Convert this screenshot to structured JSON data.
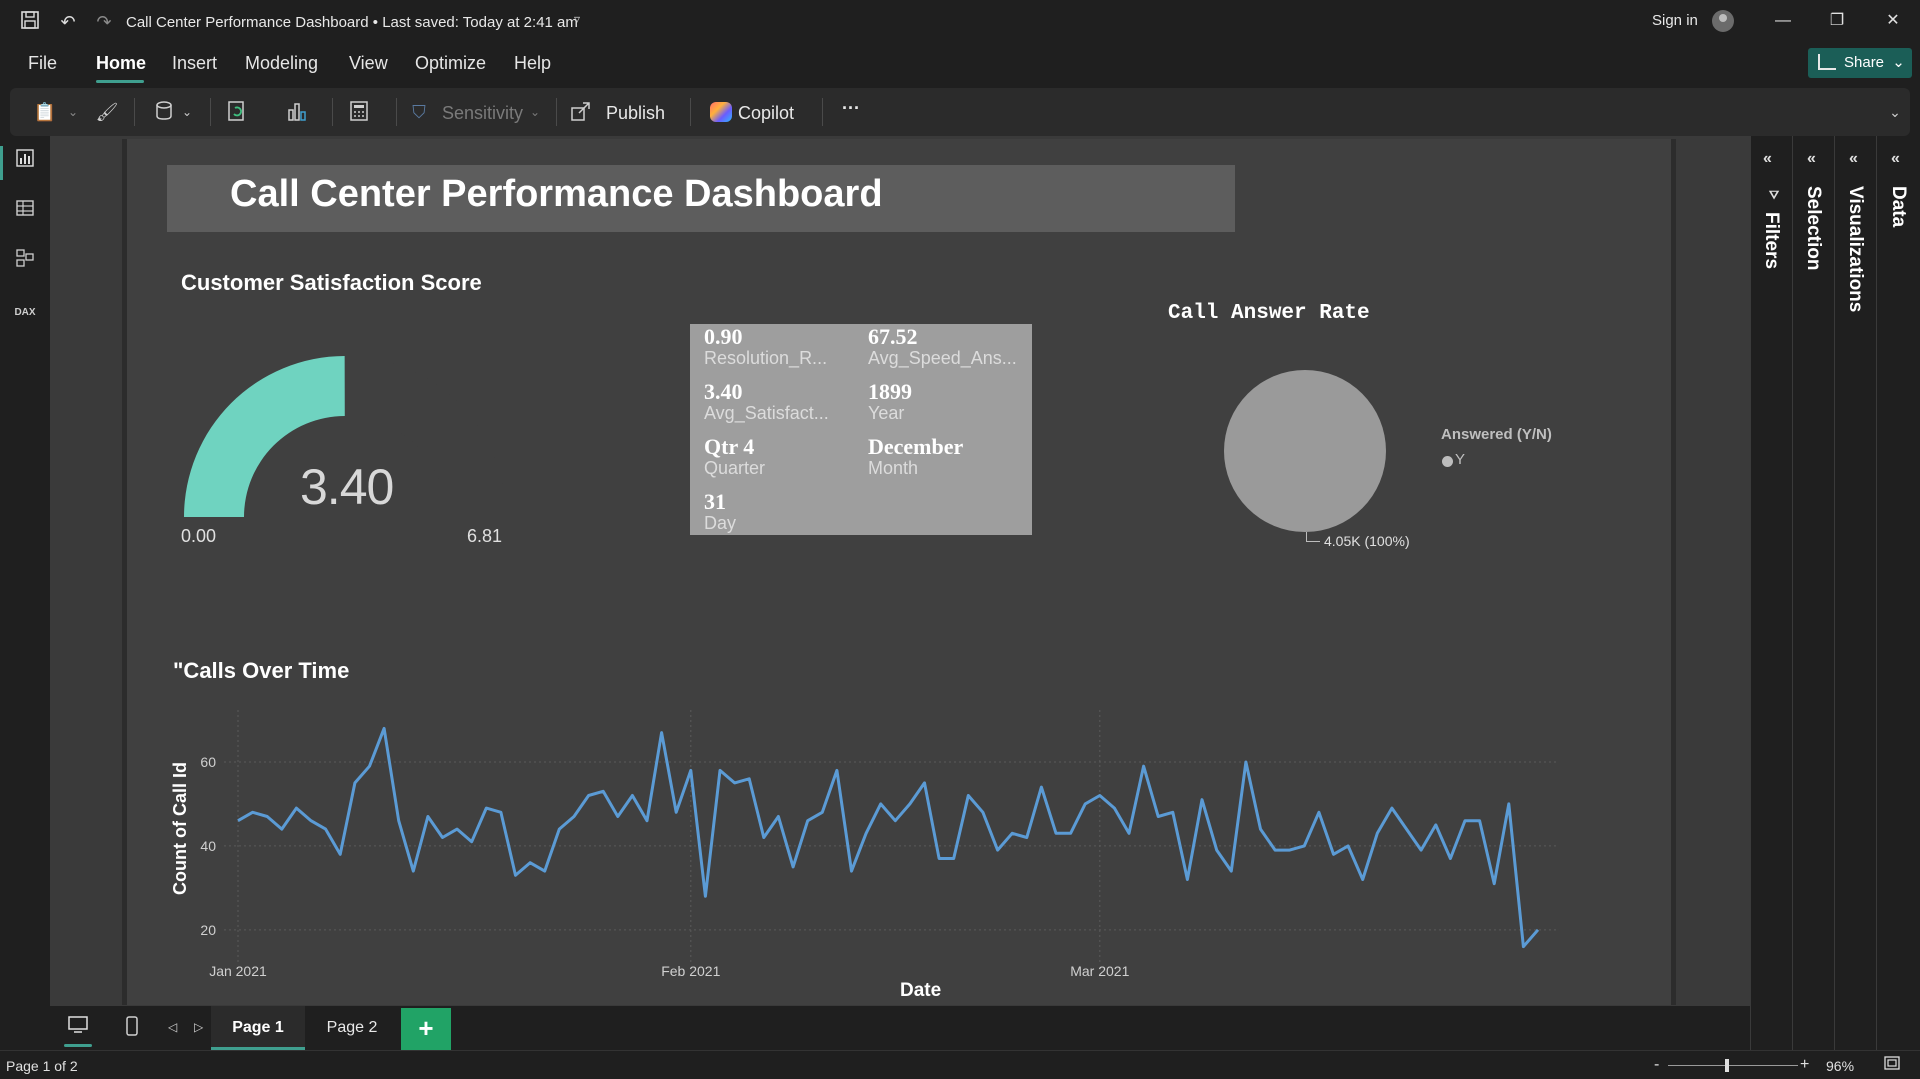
{
  "titlebar": {
    "document_title": "Call Center Performance Dashboard • Last saved: Today at 2:41 am",
    "signin": "Sign in",
    "icons": [
      "save-icon",
      "undo-icon",
      "redo-icon"
    ]
  },
  "menu": {
    "tabs": [
      "File",
      "Home",
      "Insert",
      "Modeling",
      "View",
      "Optimize",
      "Help"
    ],
    "active": "Home",
    "share": "Share"
  },
  "ribbon": {
    "sensitivity": "Sensitivity",
    "publish": "Publish",
    "copilot": "Copilot",
    "more": "···"
  },
  "report": {
    "title": "Call Center Performance Dashboard",
    "gauge": {
      "title": "Customer Satisfaction Score",
      "value": "3.40",
      "min": "0.00",
      "max": "6.81",
      "fill_fraction": 0.4993,
      "color": "#6fd3c0"
    },
    "card": {
      "rows": [
        {
          "value": "0.90",
          "label": "Resolution_R..."
        },
        {
          "value": "67.52",
          "label": "Avg_Speed_Ans..."
        },
        {
          "value": "3.40",
          "label": "Avg_Satisfact..."
        },
        {
          "value": "1899",
          "label": "Year"
        },
        {
          "value": "Qtr 4",
          "label": "Quarter"
        },
        {
          "value": "December",
          "label": "Month"
        },
        {
          "value": "31",
          "label": "Day"
        }
      ]
    },
    "pie": {
      "title": "Call Answer Rate",
      "legend_title": "Answered (Y/N)",
      "legend_item": "Y",
      "slice_label": "4.05K (100%)"
    },
    "line_title": "\"Calls Over Time"
  },
  "chart_data": {
    "type": "line",
    "title": "\"Calls Over Time",
    "xlabel": "Date",
    "ylabel": "Count of Call Id",
    "x_tick_labels": [
      "Jan 2021",
      "Feb 2021",
      "Mar 2021"
    ],
    "y_tick_labels": [
      "20",
      "40",
      "60"
    ],
    "ylim": [
      14,
      70
    ],
    "x_range_days": [
      0,
      89
    ],
    "series": [
      {
        "color": "#5b9bd5",
        "x": [
          0,
          1,
          2,
          3,
          4,
          5,
          6,
          7,
          8,
          9,
          10,
          11,
          12,
          13,
          14,
          15,
          16,
          17,
          18,
          19,
          20,
          21,
          22,
          23,
          24,
          25,
          26,
          27,
          28,
          29,
          30,
          31,
          32,
          33,
          34,
          35,
          36,
          37,
          38,
          39,
          40,
          41,
          42,
          43,
          44,
          45,
          46,
          47,
          48,
          49,
          50,
          51,
          52,
          53,
          54,
          55,
          56,
          57,
          58,
          59,
          60,
          61,
          62,
          63,
          64,
          65,
          66,
          67,
          68,
          69,
          70,
          71,
          72,
          73,
          74,
          75,
          76,
          77,
          78,
          79,
          80,
          81,
          82,
          83,
          84,
          85,
          86,
          87,
          88,
          89
        ],
        "values": [
          46,
          48,
          47,
          44,
          49,
          46,
          44,
          38,
          55,
          59,
          68,
          46,
          34,
          47,
          42,
          44,
          41,
          49,
          48,
          33,
          36,
          34,
          44,
          47,
          52,
          53,
          47,
          52,
          46,
          67,
          48,
          58,
          28,
          58,
          55,
          56,
          42,
          47,
          35,
          46,
          48,
          58,
          34,
          43,
          50,
          46,
          50,
          55,
          37,
          37,
          52,
          48,
          39,
          43,
          42,
          54,
          43,
          43,
          50,
          52,
          49,
          43,
          59,
          47,
          48,
          32,
          51,
          39,
          34,
          60,
          44,
          39,
          39,
          40,
          48,
          38,
          40,
          32,
          43,
          49,
          44,
          39,
          45,
          37,
          46,
          46,
          31,
          50,
          16,
          20
        ]
      }
    ],
    "grid": true
  },
  "panes": [
    "Filters",
    "Selection",
    "Visualizations",
    "Data"
  ],
  "pages": {
    "tabs": [
      "Page 1",
      "Page 2"
    ],
    "active": "Page 1",
    "add": "+"
  },
  "status": {
    "page_text": "Page 1 of 2",
    "zoom": "96%",
    "zoom_minus": "-",
    "zoom_plus": "+"
  }
}
